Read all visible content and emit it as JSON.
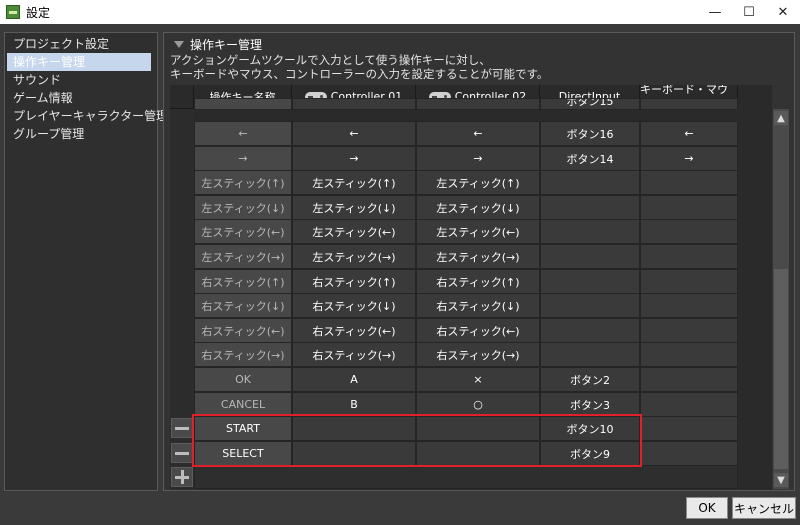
{
  "window": {
    "title": "設定",
    "minimize": "—",
    "maximize": "☐",
    "close": "✕"
  },
  "sidebar": {
    "items": [
      {
        "label": "プロジェクト設定"
      },
      {
        "label": "操作キー管理"
      },
      {
        "label": "サウンド"
      },
      {
        "label": "ゲーム情報"
      },
      {
        "label": "プレイヤーキャラクター管理"
      },
      {
        "label": "グループ管理"
      }
    ],
    "active_index": 1
  },
  "panel": {
    "title": "操作キー管理",
    "description_line1": "アクションゲームツクールで入力として使う操作キーに対し、",
    "description_line2": "キーボードやマウス、コントローラーの入力を設定することが可能です。"
  },
  "table": {
    "headers": [
      "操作キー名称",
      "Controller 01",
      "Controller 02",
      "DirectInput",
      "キーボード・マウス"
    ],
    "partial_row": [
      "",
      "",
      "",
      "ボタン15",
      ""
    ],
    "rows": [
      {
        "cells": [
          "←",
          "←",
          "←",
          "ボタン16",
          "←"
        ],
        "bright": false
      },
      {
        "cells": [
          "→",
          "→",
          "→",
          "ボタン14",
          "→"
        ],
        "bright": false
      },
      {
        "cells": [
          "左スティック(↑)",
          "左スティック(↑)",
          "左スティック(↑)",
          "",
          ""
        ],
        "bright": false
      },
      {
        "cells": [
          "左スティック(↓)",
          "左スティック(↓)",
          "左スティック(↓)",
          "",
          ""
        ],
        "bright": false
      },
      {
        "cells": [
          "左スティック(←)",
          "左スティック(←)",
          "左スティック(←)",
          "",
          ""
        ],
        "bright": false
      },
      {
        "cells": [
          "左スティック(→)",
          "左スティック(→)",
          "左スティック(→)",
          "",
          ""
        ],
        "bright": false
      },
      {
        "cells": [
          "右スティック(↑)",
          "右スティック(↑)",
          "右スティック(↑)",
          "",
          ""
        ],
        "bright": false
      },
      {
        "cells": [
          "右スティック(↓)",
          "右スティック(↓)",
          "右スティック(↓)",
          "",
          ""
        ],
        "bright": false
      },
      {
        "cells": [
          "右スティック(←)",
          "右スティック(←)",
          "右スティック(←)",
          "",
          ""
        ],
        "bright": false
      },
      {
        "cells": [
          "右スティック(→)",
          "右スティック(→)",
          "右スティック(→)",
          "",
          ""
        ],
        "bright": false
      },
      {
        "cells": [
          "OK",
          "A",
          "×",
          "ボタン2",
          ""
        ],
        "bright": false
      },
      {
        "cells": [
          "CANCEL",
          "B",
          "○",
          "ボタン3",
          ""
        ],
        "bright": false
      },
      {
        "cells": [
          "START",
          "",
          "",
          "ボタン10",
          ""
        ],
        "bright": true,
        "removable": true
      },
      {
        "cells": [
          "SELECT",
          "",
          "",
          "ボタン9",
          ""
        ],
        "bright": true,
        "removable": true
      }
    ]
  },
  "scroll": {
    "up": "▲",
    "down": "▼"
  },
  "footer": {
    "ok_label": "OK",
    "cancel_label": "キャンセル"
  },
  "colors": {
    "highlight": "#e0202a",
    "selected": "#c6d6ec"
  }
}
